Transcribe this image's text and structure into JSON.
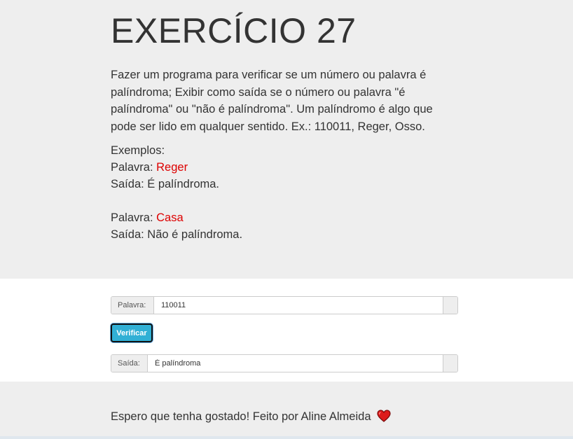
{
  "header": {
    "title": "EXERCÍCIO 27",
    "description": "Fazer um programa para verificar se um número ou palavra é palíndroma; Exibir como saída se o número ou palavra \"é palíndroma\" ou \"não é palíndroma\". Um palíndromo é algo que pode ser lido em qualquer sentido. Ex.: 110011, Reger, Osso."
  },
  "examples": {
    "heading": "Exemplos:",
    "items": [
      {
        "word_label": "Palavra:",
        "word": "Reger",
        "output": "Saída: É palíndroma."
      },
      {
        "word_label": "Palavra:",
        "word": "Casa",
        "output": "Saída: Não é palíndroma."
      }
    ]
  },
  "form": {
    "input_label": "Palavra:",
    "input_value": "110011",
    "button_label": "Verificar",
    "output_label": "Saída:",
    "output_value": "É palíndroma"
  },
  "footer": {
    "text": "Espero que tenha gostado! Feito por Aline Almeida",
    "icon": "heart-icon"
  },
  "colors": {
    "hero_bg": "#eeeeee",
    "highlight": "#dd0000",
    "button": "#31b0d5",
    "heart": "#dd1c1c"
  }
}
